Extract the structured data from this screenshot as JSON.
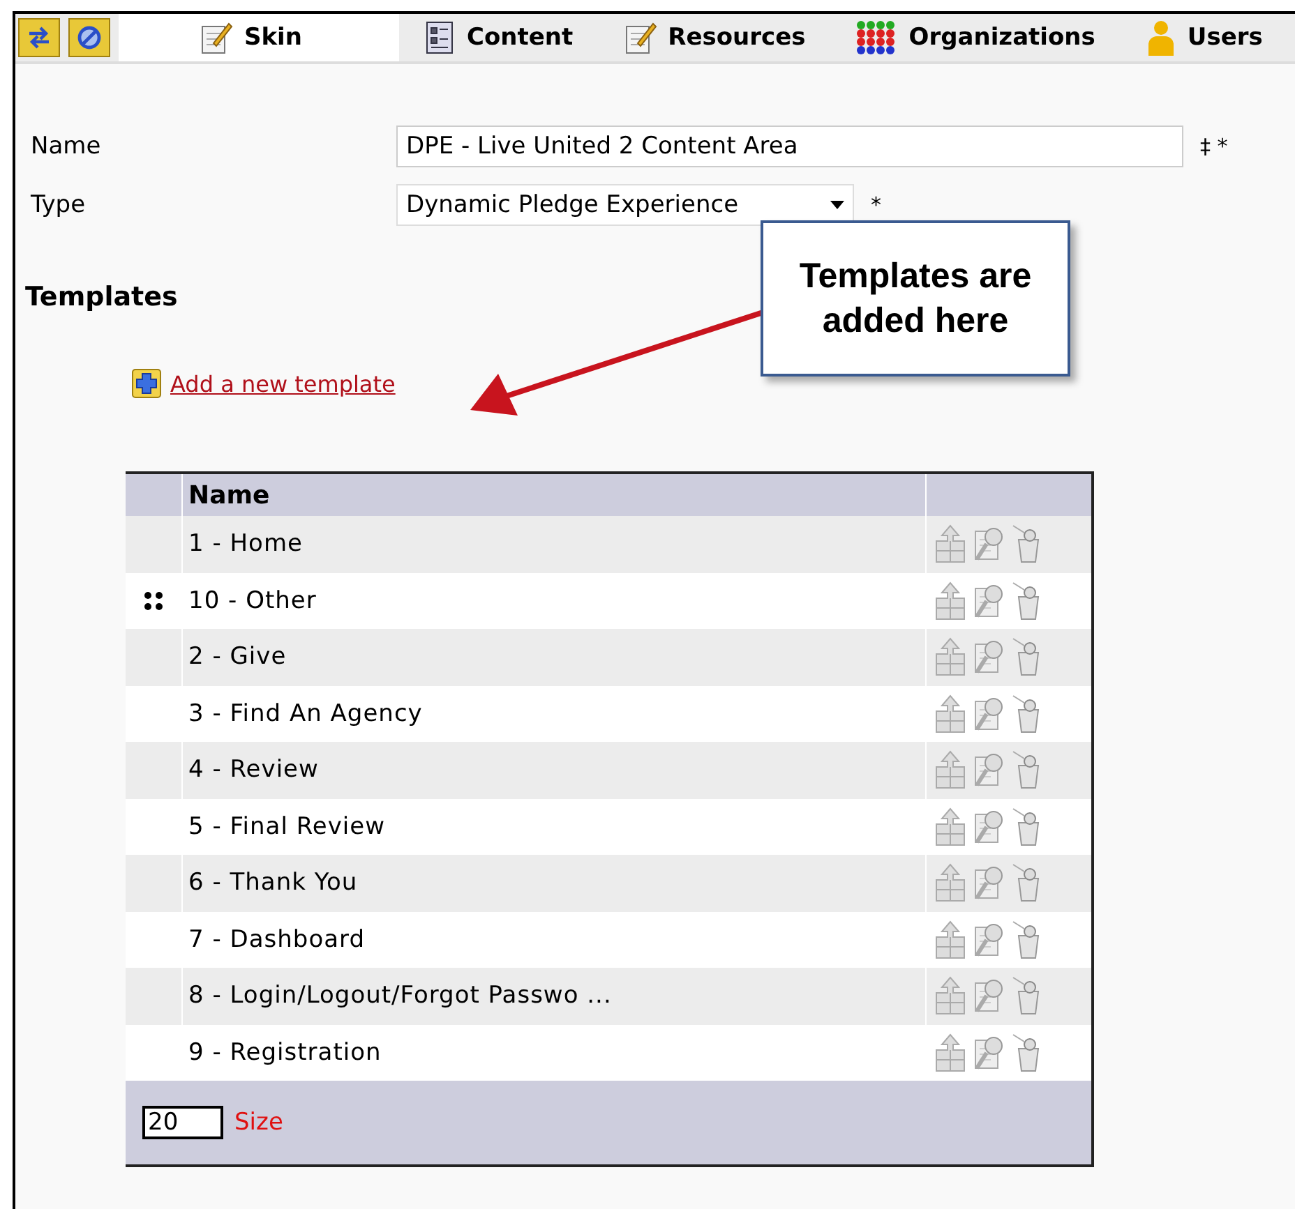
{
  "toolbar": {
    "tabs": [
      {
        "label": "Skin",
        "kind": "note",
        "selected": true
      },
      {
        "label": "Content",
        "kind": "list",
        "selected": false
      },
      {
        "label": "Resources",
        "kind": "note",
        "selected": false
      },
      {
        "label": "Organizations",
        "kind": "dots",
        "selected": false
      },
      {
        "label": "Users",
        "kind": "user",
        "selected": false
      }
    ]
  },
  "form": {
    "name": {
      "label": "Name",
      "value": "DPE - Live United 2 Content Area",
      "marks": "‡ *"
    },
    "type": {
      "label": "Type",
      "value": "Dynamic Pledge Experience",
      "marks": "*"
    }
  },
  "templates": {
    "heading": "Templates",
    "add_link": "Add a new template",
    "callout": "Templates are added here",
    "table": {
      "columns": [
        "Name"
      ],
      "rows": [
        {
          "name": "1 - Home",
          "drag_handle": false
        },
        {
          "name": "10 - Other",
          "drag_handle": true
        },
        {
          "name": "2 - Give",
          "drag_handle": false
        },
        {
          "name": "3 - Find An Agency",
          "drag_handle": false
        },
        {
          "name": "4 - Review",
          "drag_handle": false
        },
        {
          "name": "5 - Final Review",
          "drag_handle": false
        },
        {
          "name": "6 - Thank You",
          "drag_handle": false
        },
        {
          "name": "7 - Dashboard",
          "drag_handle": false
        },
        {
          "name": "8 - Login/Logout/Forgot Passwo ...",
          "drag_handle": false
        },
        {
          "name": "9 - Registration",
          "drag_handle": false
        }
      ],
      "page_size": {
        "value": "20",
        "label": "Size"
      }
    }
  }
}
